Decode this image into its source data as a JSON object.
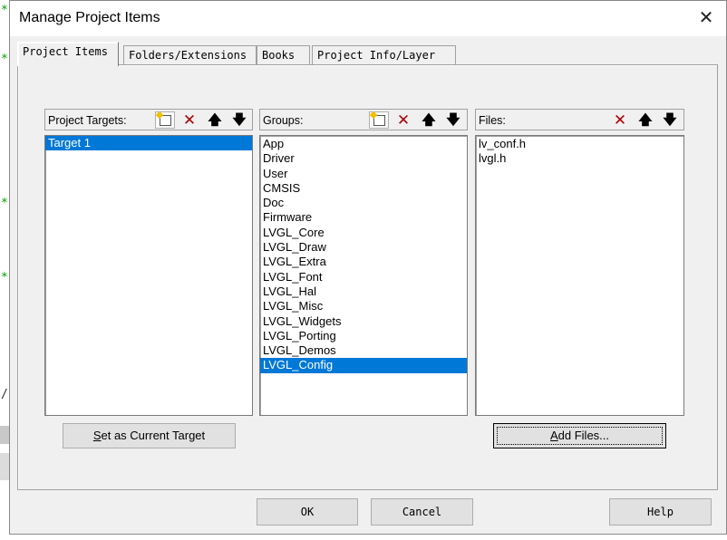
{
  "window": {
    "title": "Manage Project Items",
    "close_glyph": "✕"
  },
  "tabs": [
    {
      "label": "Project Items",
      "active": true
    },
    {
      "label": "Folders/Extensions",
      "active": false
    },
    {
      "label": "Books",
      "active": false
    },
    {
      "label": "Project Info/Layer",
      "active": false
    }
  ],
  "targets": {
    "label": "Project Targets:",
    "items": [
      "Target 1"
    ],
    "selected": 0
  },
  "groups": {
    "label": "Groups:",
    "items": [
      "App",
      "Driver",
      "User",
      "CMSIS",
      "Doc",
      "Firmware",
      "LVGL_Core",
      "LVGL_Draw",
      "LVGL_Extra",
      "LVGL_Font",
      "LVGL_Hal",
      "LVGL_Misc",
      "LVGL_Widgets",
      "LVGL_Porting",
      "LVGL_Demos",
      "LVGL_Config"
    ],
    "selected": 15
  },
  "files": {
    "label": "Files:",
    "items": [
      "lv_conf.h",
      "lvgl.h"
    ]
  },
  "buttons": {
    "set_target_prefix": "S",
    "set_target_rest": "et as Current Target",
    "add_files_prefix": "A",
    "add_files_rest": "dd Files...",
    "ok": "OK",
    "cancel": "Cancel",
    "help": "Help"
  },
  "icons": {
    "new": "new-item-icon",
    "delete": "delete-icon",
    "up": "move-up-icon",
    "down": "move-down-icon"
  },
  "glyphs": {
    "delete": "✕",
    "up": "🡅",
    "down": "🡇"
  },
  "background": {
    "marks": [
      "*",
      "*",
      "*",
      "*",
      "/"
    ]
  }
}
